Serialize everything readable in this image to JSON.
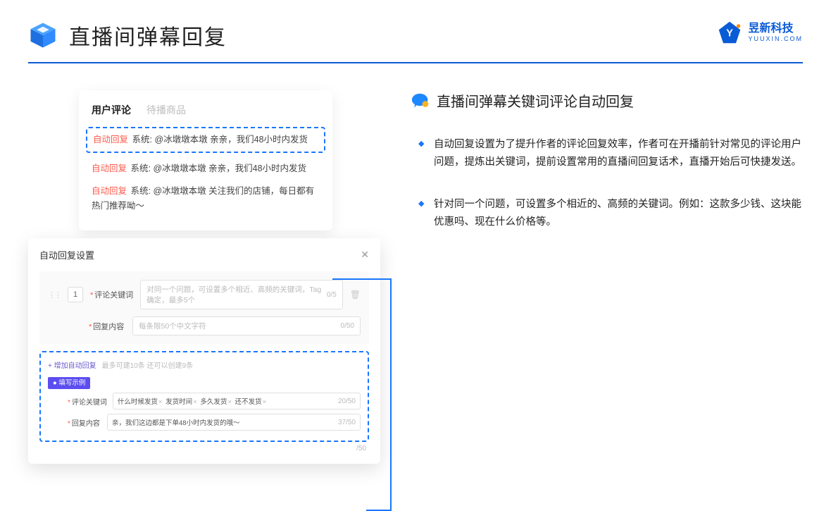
{
  "header": {
    "title": "直播间弹幕回复",
    "brand_cn": "昱新科技",
    "brand_en": "YUUXIN.COM"
  },
  "comments": {
    "tab_active": "用户评论",
    "tab_inactive": "待播商品",
    "tag_auto": "自动回复",
    "sys_prefix": "系统: ",
    "row1_mention": "@冰墩墩本墩 亲亲，我们48小时内发货",
    "row2": "@冰墩墩本墩 亲亲，我们48小时内发货",
    "row3": "@冰墩墩本墩 关注我们的店铺，每日都有热门推荐呦～"
  },
  "dialog": {
    "title": "自动回复设置",
    "idx": "1",
    "kw_label": "评论关键词",
    "kw_placeholder": "对同一个问题，可设置多个相近、高频的关键词，Tag确定，最多5个",
    "kw_count": "0/5",
    "content_label": "回复内容",
    "content_placeholder": "每条限50个中文字符",
    "content_count": "0/50",
    "add_link": "+ 增加自动回复",
    "add_hint": "最多可建10条 还可以创建9条",
    "example_badge": "● 填写示例",
    "ex_kw_label": "评论关键词",
    "ex_kw_tags": [
      "什么时候发货",
      "发货时间",
      "多久发货",
      "还不发货"
    ],
    "ex_kw_count": "20/50",
    "ex_content_label": "回复内容",
    "ex_content_val": "亲，我们这边都是下单48小时内发货的哦～",
    "ex_content_count": "37/50",
    "outer_count": "/50"
  },
  "right": {
    "subtitle": "直播间弹幕关键词评论自动回复",
    "bullets": [
      "自动回复设置为了提升作者的评论回复效率，作者可在开播前针对常见的评论用户问题，提炼出关键词，提前设置常用的直播间回复话术，直播开始后可快捷发送。",
      "针对同一个问题，可设置多个相近的、高频的关键词。例如：这款多少钱、这块能优惠吗、现在什么价格等。"
    ]
  }
}
